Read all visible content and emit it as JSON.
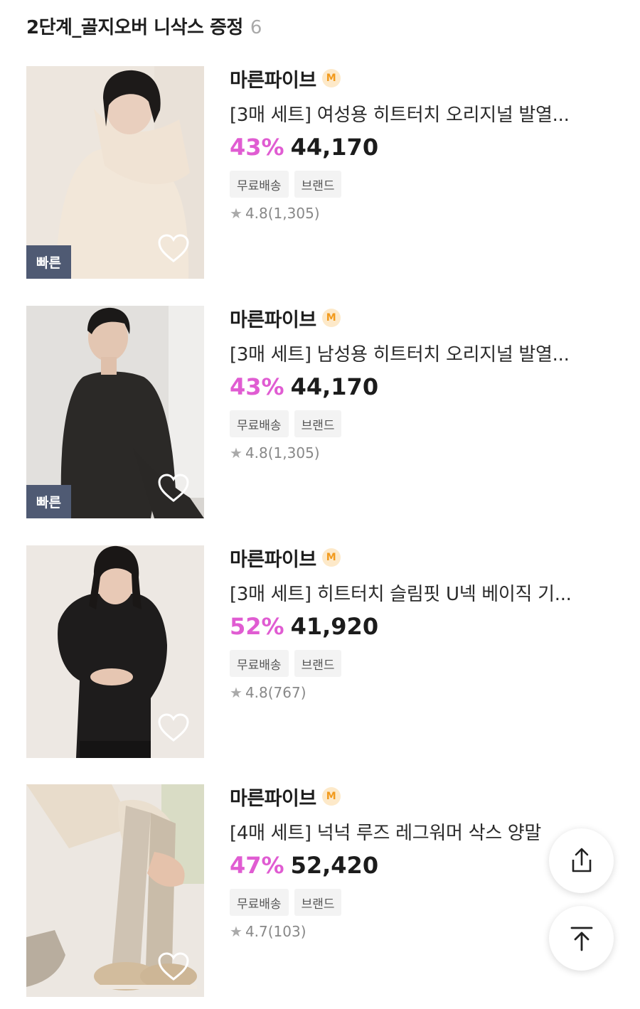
{
  "section": {
    "title": "2단계_골지오버 니삭스 증정",
    "count": "6"
  },
  "products": [
    {
      "brand": "마른파이브",
      "brand_badge": "M",
      "title": "[3매 세트] 여성용 히트터치 오리지널 발열...",
      "discount": "43%",
      "price": "44,170",
      "tags": [
        "무료배송",
        "브랜드"
      ],
      "rating": "4.8",
      "reviews": "(1,305)",
      "fast_badge": "빠른"
    },
    {
      "brand": "마른파이브",
      "brand_badge": "M",
      "title": "[3매 세트] 남성용 히트터치 오리지널 발열...",
      "discount": "43%",
      "price": "44,170",
      "tags": [
        "무료배송",
        "브랜드"
      ],
      "rating": "4.8",
      "reviews": "(1,305)",
      "fast_badge": "빠른"
    },
    {
      "brand": "마른파이브",
      "brand_badge": "M",
      "title": "[3매 세트] 히트터치 슬림핏 U넥 베이직 기...",
      "discount": "52%",
      "price": "41,920",
      "tags": [
        "무료배송",
        "브랜드"
      ],
      "rating": "4.8",
      "reviews": "(767)"
    },
    {
      "brand": "마른파이브",
      "brand_badge": "M",
      "title": "[4매 세트] 넉넉 루즈 레그워머 삭스 양말",
      "discount": "47%",
      "price": "52,420",
      "tags": [
        "무료배송",
        "브랜드"
      ],
      "rating": "4.7",
      "reviews": "(103)"
    }
  ],
  "colors": {
    "discount": "#e05cd2",
    "fast_badge_bg": "#4f5a73",
    "brand_badge": "#f29a1c"
  },
  "icons": {
    "star": "★",
    "heart": "heart-outline-icon",
    "share": "share-icon",
    "scroll_top": "arrow-up-to-line-icon"
  }
}
